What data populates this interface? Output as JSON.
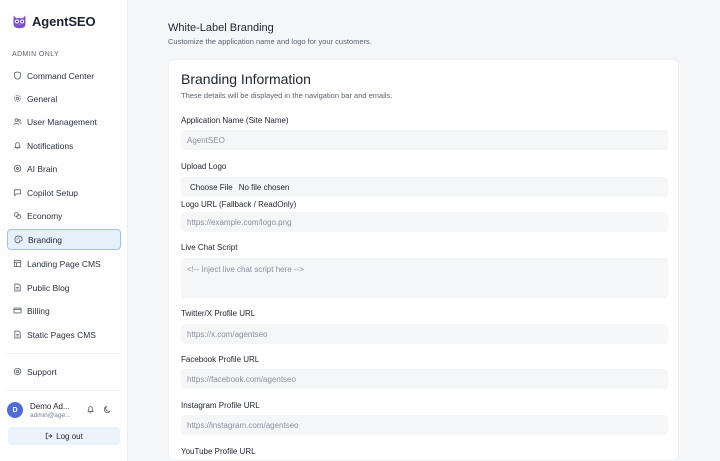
{
  "app": {
    "name": "AgentSEO"
  },
  "sidebar": {
    "section_label": "ADMIN ONLY",
    "items": [
      {
        "label": "Command Center",
        "icon": "shield-icon"
      },
      {
        "label": "General",
        "icon": "gear-icon"
      },
      {
        "label": "User Management",
        "icon": "users-icon"
      },
      {
        "label": "Notifications",
        "icon": "bell-icon"
      },
      {
        "label": "AI Brain",
        "icon": "brain-icon"
      },
      {
        "label": "Copilot Setup",
        "icon": "chat-icon"
      },
      {
        "label": "Economy",
        "icon": "coins-icon"
      },
      {
        "label": "Branding",
        "icon": "palette-icon",
        "active": true
      },
      {
        "label": "Landing Page CMS",
        "icon": "layout-icon"
      },
      {
        "label": "Public Blog",
        "icon": "document-icon"
      },
      {
        "label": "Billing",
        "icon": "credit-card-icon"
      },
      {
        "label": "Static Pages CMS",
        "icon": "document-icon"
      }
    ],
    "support_label": "Support",
    "user": {
      "initial": "D",
      "name": "Demo Ad...",
      "email": "admin@age..."
    },
    "logout_label": "Log out"
  },
  "main": {
    "title": "White-Label Branding",
    "subtitle": "Customize the application name and logo for your customers.",
    "card": {
      "title": "Branding Information",
      "subtitle": "These details will be displayed in the navigation bar and emails.",
      "fields": {
        "app_name": {
          "label": "Application Name (Site Name)",
          "placeholder": "AgentSEO"
        },
        "upload_logo": {
          "label": "Upload Logo",
          "button": "Choose File",
          "status": "No file chosen"
        },
        "logo_url": {
          "label": "Logo URL (Fallback / ReadOnly)",
          "placeholder": "https://example.com/logo.png"
        },
        "live_chat": {
          "label": "Live Chat Script",
          "placeholder": "<!-- Inject live chat script here -->"
        },
        "twitter": {
          "label": "Twitter/X Profile URL",
          "placeholder": "https://x.com/agentseo"
        },
        "facebook": {
          "label": "Facebook Profile URL",
          "placeholder": "https://facebook.com/agentseo"
        },
        "instagram": {
          "label": "Instagram Profile URL",
          "placeholder": "https://instagram.com/agentseo"
        },
        "youtube": {
          "label": "YouTube Profile URL"
        }
      }
    }
  },
  "colors": {
    "brand": "#7a4fd0",
    "active_bg": "#e6f0fb",
    "active_border": "#9ec3ea",
    "avatar": "#4f6bd8"
  }
}
